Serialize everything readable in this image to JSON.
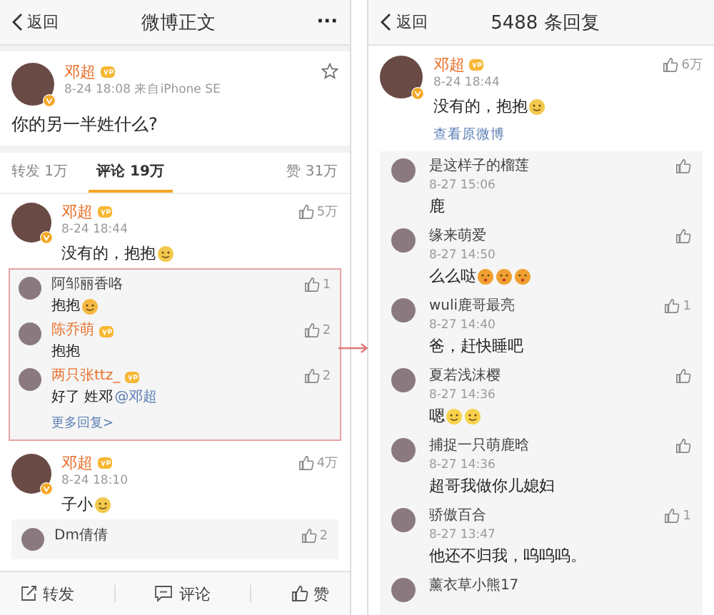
{
  "left": {
    "header": {
      "back": "返回",
      "title": "微博正文",
      "more": "···"
    },
    "post": {
      "author": "邓超",
      "verified": true,
      "vip": true,
      "time": "8-24 18:08",
      "source": "来自iPhone SE",
      "text": "你的另一半姓什么?"
    },
    "tabs": [
      {
        "label": "转发 1万",
        "selected": false
      },
      {
        "label": "评论 19万",
        "selected": true
      },
      {
        "label": "赞 31万",
        "selected": false
      }
    ],
    "comments": [
      {
        "author": "邓超",
        "verified": true,
        "vip": true,
        "time": "8-24 18:44",
        "text": "没有的，抱抱",
        "emojis": [
          {
            "kind": "cat"
          }
        ],
        "likes": "5万",
        "highlighted": true,
        "replies": [
          {
            "author": "阿邹丽香咯",
            "vip": false,
            "text": "抱抱",
            "emojis": [
              {
                "kind": "grin"
              }
            ],
            "likes": "1"
          },
          {
            "author": "陈乔萌",
            "vip": true,
            "text": "抱抱",
            "likes": "2"
          },
          {
            "author": "两只张ttz_",
            "vip": true,
            "text": "好了 姓邓",
            "mention": "@邓超",
            "likes": "2"
          }
        ],
        "more": "更多回复>"
      },
      {
        "author": "邓超",
        "verified": true,
        "vip": true,
        "time": "8-24 18:10",
        "text": "子小",
        "emojis": [
          {
            "kind": "cat"
          }
        ],
        "likes": "4万",
        "highlighted": false,
        "replies": [
          {
            "author": "Dm倩倩",
            "vip": false,
            "likes": "2"
          }
        ]
      }
    ],
    "bottom_bar": [
      "转发",
      "评论",
      "赞"
    ]
  },
  "right": {
    "header": {
      "back": "返回",
      "title": "5488 条回复"
    },
    "comment": {
      "author": "邓超",
      "verified": true,
      "vip": true,
      "time": "8-24 18:44",
      "text": "没有的，抱抱",
      "emojis": [
        {
          "kind": "cat"
        }
      ],
      "likes": "6万",
      "link": "查看原微博"
    },
    "replies": [
      {
        "author": "是这样子的榴莲",
        "time": "8-27 15:06",
        "text": "鹿"
      },
      {
        "author": "缘来萌爱",
        "time": "8-27 14:50",
        "text": "么么哒",
        "emojis": [
          {
            "kind": "kiss"
          },
          {
            "kind": "kiss"
          },
          {
            "kind": "kiss"
          }
        ]
      },
      {
        "author": "wuli鹿哥最亮",
        "time": "8-27 14:40",
        "text": "爸，赶快睡吧",
        "likes": "1"
      },
      {
        "author": "夏若浅沫樱",
        "time": "8-27 14:36",
        "text": "嗯",
        "emojis": [
          {
            "kind": "smile"
          },
          {
            "kind": "smile"
          }
        ]
      },
      {
        "author": "捕捉一只萌鹿晗",
        "time": "8-27 14:36",
        "text": "超哥我做你儿媳妇"
      },
      {
        "author": "骄傲百合",
        "time": "8-27 13:47",
        "text": "他还不归我，呜呜呜。",
        "likes": "1"
      },
      {
        "author": "薰衣草小熊17"
      }
    ]
  }
}
